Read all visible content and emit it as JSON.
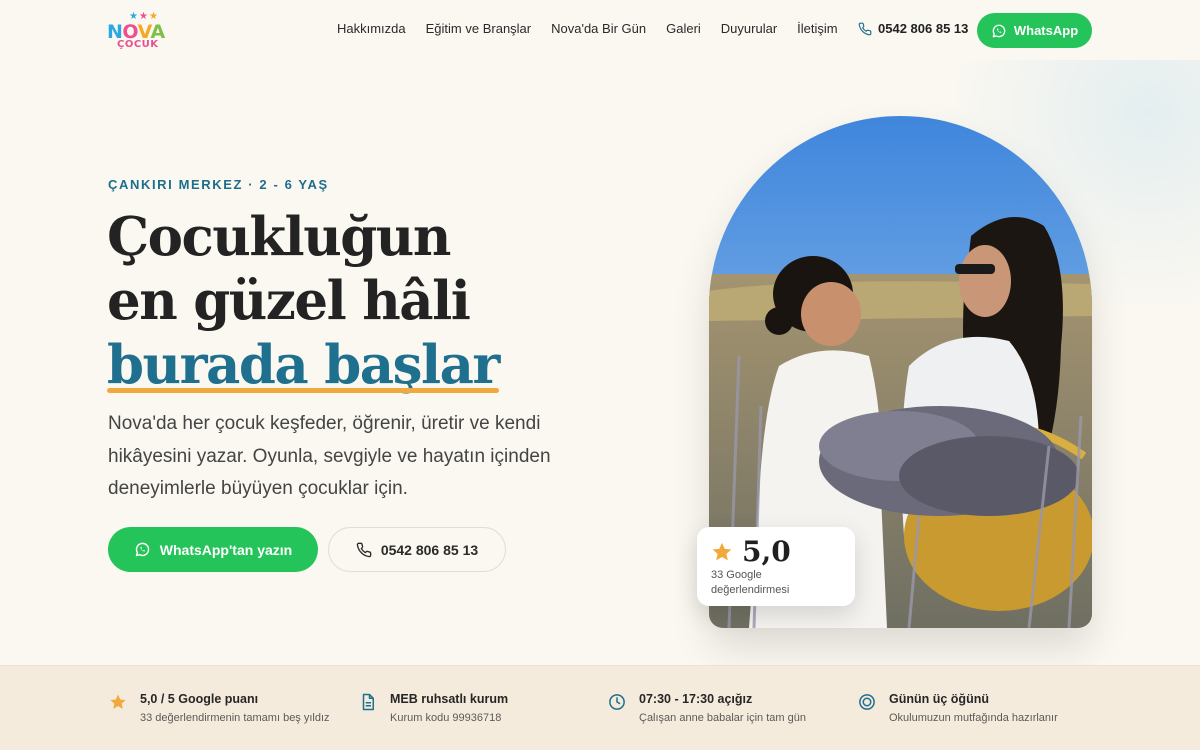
{
  "brand": {
    "logo_word": "NOVA",
    "logo_sub": "ÇOCUK"
  },
  "nav": {
    "items": [
      "Hakkımızda",
      "Eğitim ve Branşlar",
      "Nova'da Bir Gün",
      "Galeri",
      "Duyurular",
      "İletişim"
    ],
    "phone": "0542 806 85 13",
    "whatsapp_label": "WhatsApp"
  },
  "hero": {
    "eyebrow": "ÇANKIRI MERKEZ · 2 - 6 YAŞ",
    "headline_line1": "Çocukluğun",
    "headline_line2": "en güzel hâli",
    "headline_accent": "burada başlar",
    "lede": "Nova'da her çocuk keşfeder, öğrenir, üretir ve kendi hikâyesini yazar. Oyunla, sevgiyle ve hayatın içinden deneyimlerle büyüyen çocuklar için.",
    "cta_whatsapp": "WhatsApp'tan yazın",
    "cta_phone": "0542 806 85 13"
  },
  "rating": {
    "score": "5,0",
    "caption": "33 Google değerlendirmesi"
  },
  "features": [
    {
      "icon": "star-icon",
      "title": "5,0 / 5 Google puanı",
      "sub": "33 değerlendirmenin tamamı beş yıldız"
    },
    {
      "icon": "document-icon",
      "title": "MEB ruhsatlı kurum",
      "sub": "Kurum kodu 99936718"
    },
    {
      "icon": "clock-icon",
      "title": "07:30 - 17:30 açığız",
      "sub": "Çalışan anne babalar için tam gün"
    },
    {
      "icon": "plate-icon",
      "title": "Günün üç öğünü",
      "sub": "Okulumuzun mutfağında hazırlanır"
    }
  ],
  "colors": {
    "background": "#fbf8f1",
    "whatsapp_green": "#25c45a",
    "accent_blue": "#1f6f8e",
    "underline_orange": "#f2a93b",
    "feature_bar": "#f4ebdd"
  }
}
